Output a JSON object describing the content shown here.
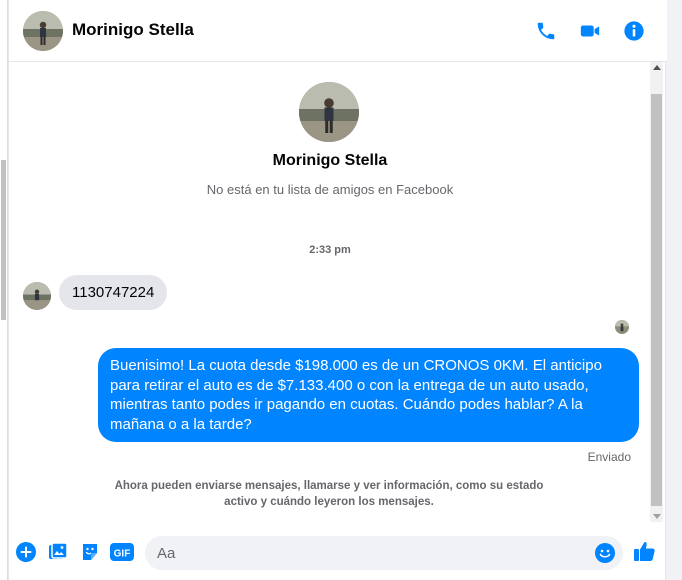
{
  "contact": {
    "name": "Morinigo Stella",
    "subtitle": "No está en tu lista de amigos en Facebook"
  },
  "header": {
    "actions": [
      "phone-icon",
      "video-icon",
      "info-icon"
    ]
  },
  "conversation": {
    "timestamp": "2:33 pm",
    "incoming_message": "1130747224",
    "outgoing_message": "Buenisimo! La cuota desde $198.000 es de un CRONOS 0KM. El anticipo para retirar el auto es de $7.133.400 o con la entrega de un auto usado, mientras tanto podes ir pagando en cuotas. Cuándo podes hablar? A la mañana o a la tarde?",
    "status": "Enviado",
    "notice": "Ahora pueden enviarse mensajes, llamarse y ver información, como su estado activo y cuándo leyeron los mensajes."
  },
  "composer": {
    "placeholder": "Aa",
    "gif_label": "GIF",
    "icons": [
      "plus-icon",
      "photo-icon",
      "sticker-icon",
      "gif-icon",
      "emoji-icon",
      "like-icon"
    ]
  },
  "colors": {
    "accent": "#0084ff",
    "bubble_in": "#e4e6eb",
    "muted": "#65676b"
  }
}
